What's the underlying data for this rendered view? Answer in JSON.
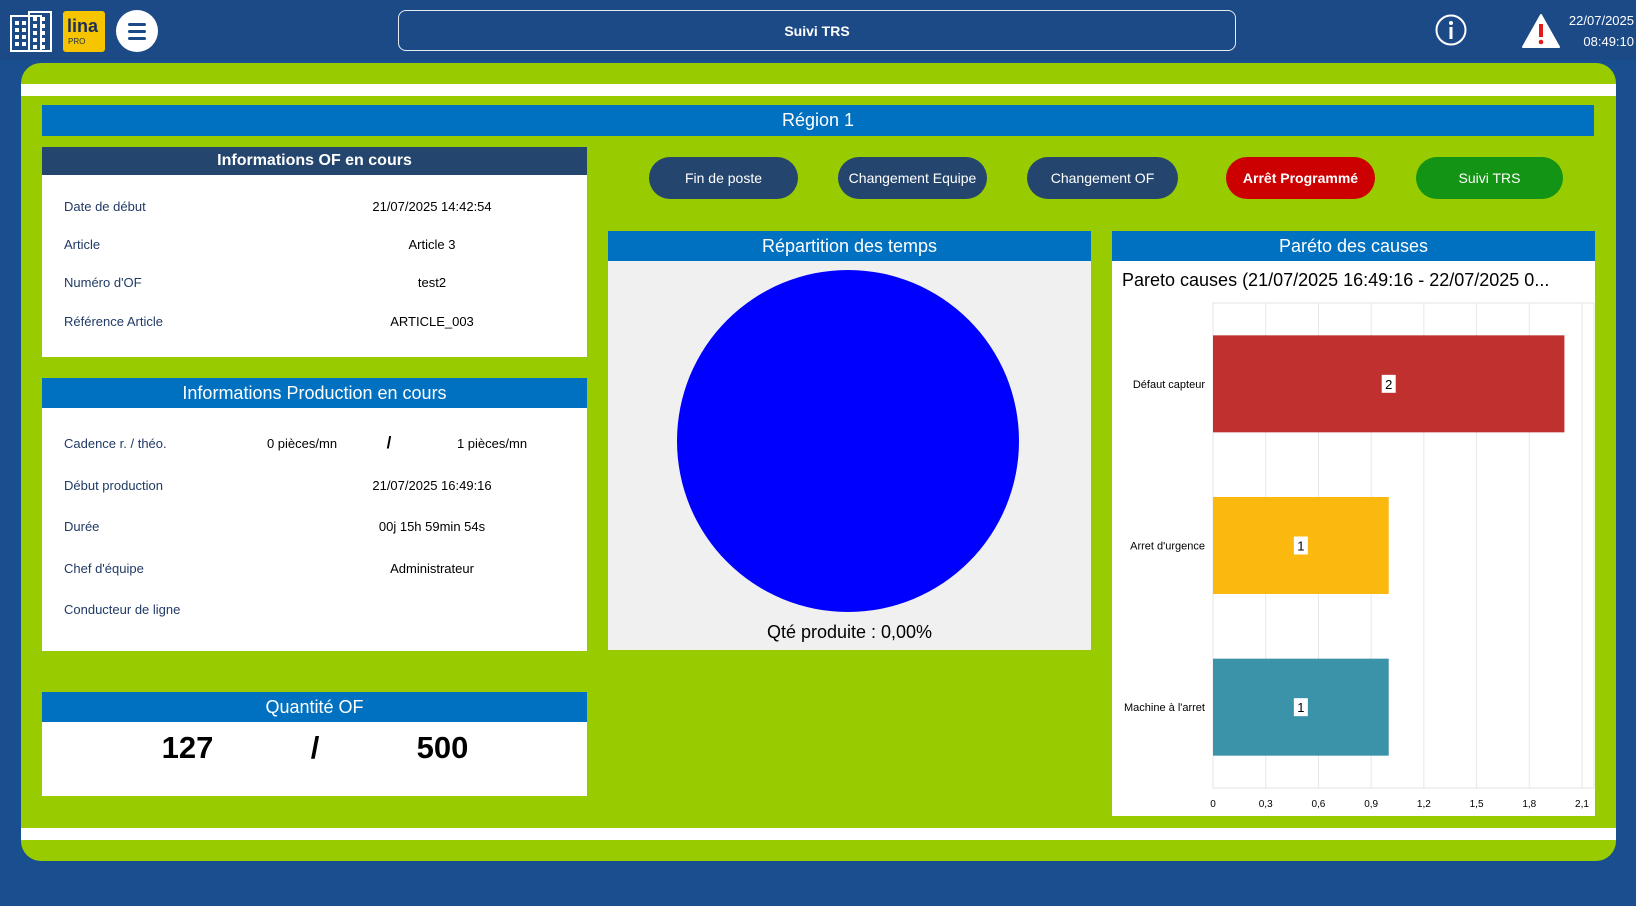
{
  "header": {
    "logo_text": "lina",
    "logo_sub": "PRO",
    "title": "Suivi TRS",
    "date": "22/07/2025",
    "time": "08:49:10"
  },
  "region": {
    "title": "Région 1"
  },
  "of_info": {
    "title": "Informations OF en cours",
    "rows": [
      {
        "label": "Date de début",
        "value": "21/07/2025 14:42:54"
      },
      {
        "label": "Article",
        "value": "Article 3"
      },
      {
        "label": "Numéro d'OF",
        "value": "test2"
      },
      {
        "label": "Référence Article",
        "value": "ARTICLE_003"
      }
    ]
  },
  "prod_info": {
    "title": "Informations Production en cours",
    "cadence_label": "Cadence r. / théo.",
    "cadence_real": "0 pièces/mn",
    "cadence_sep": "/",
    "cadence_theo": "1 pièces/mn",
    "rows": [
      {
        "label": "Début production",
        "value": "21/07/2025 16:49:16"
      },
      {
        "label": "Durée",
        "value": "00j 15h 59min 54s"
      },
      {
        "label": "Chef d'équipe",
        "value": "Administrateur"
      },
      {
        "label": "Conducteur de ligne",
        "value": ""
      }
    ]
  },
  "qty": {
    "title": "Quantité OF",
    "produced": "127",
    "sep": "/",
    "target": "500"
  },
  "actions": [
    {
      "label": "Fin de poste",
      "color": "#24466e"
    },
    {
      "label": "Changement Equipe",
      "color": "#24466e"
    },
    {
      "label": "Changement OF",
      "color": "#24466e"
    },
    {
      "label": "Arrêt Programmé",
      "color": "#cc0000"
    },
    {
      "label": "Suivi TRS",
      "color": "#149414"
    }
  ],
  "repartition": {
    "title": "Répartition des temps",
    "caption": "Qté produite : 0,00%",
    "pie_color": "#0000ff"
  },
  "pareto": {
    "title": "Paréto des causes"
  },
  "chart_data": {
    "type": "bar",
    "orientation": "horizontal",
    "title": "Pareto causes (21/07/2025 16:49:16 - 22/07/2025 0...",
    "categories": [
      "Défaut capteur",
      "Arret d'urgence",
      "Machine à l'arret"
    ],
    "values": [
      2,
      1,
      1
    ],
    "colors": [
      "#c0302f",
      "#fbb90f",
      "#3b93aa"
    ],
    "xlim": [
      0,
      2.1
    ],
    "xticks": [
      "0",
      "0,3",
      "0,6",
      "0,9",
      "1,2",
      "1,5",
      "1,8",
      "2,1"
    ],
    "grid": true
  }
}
